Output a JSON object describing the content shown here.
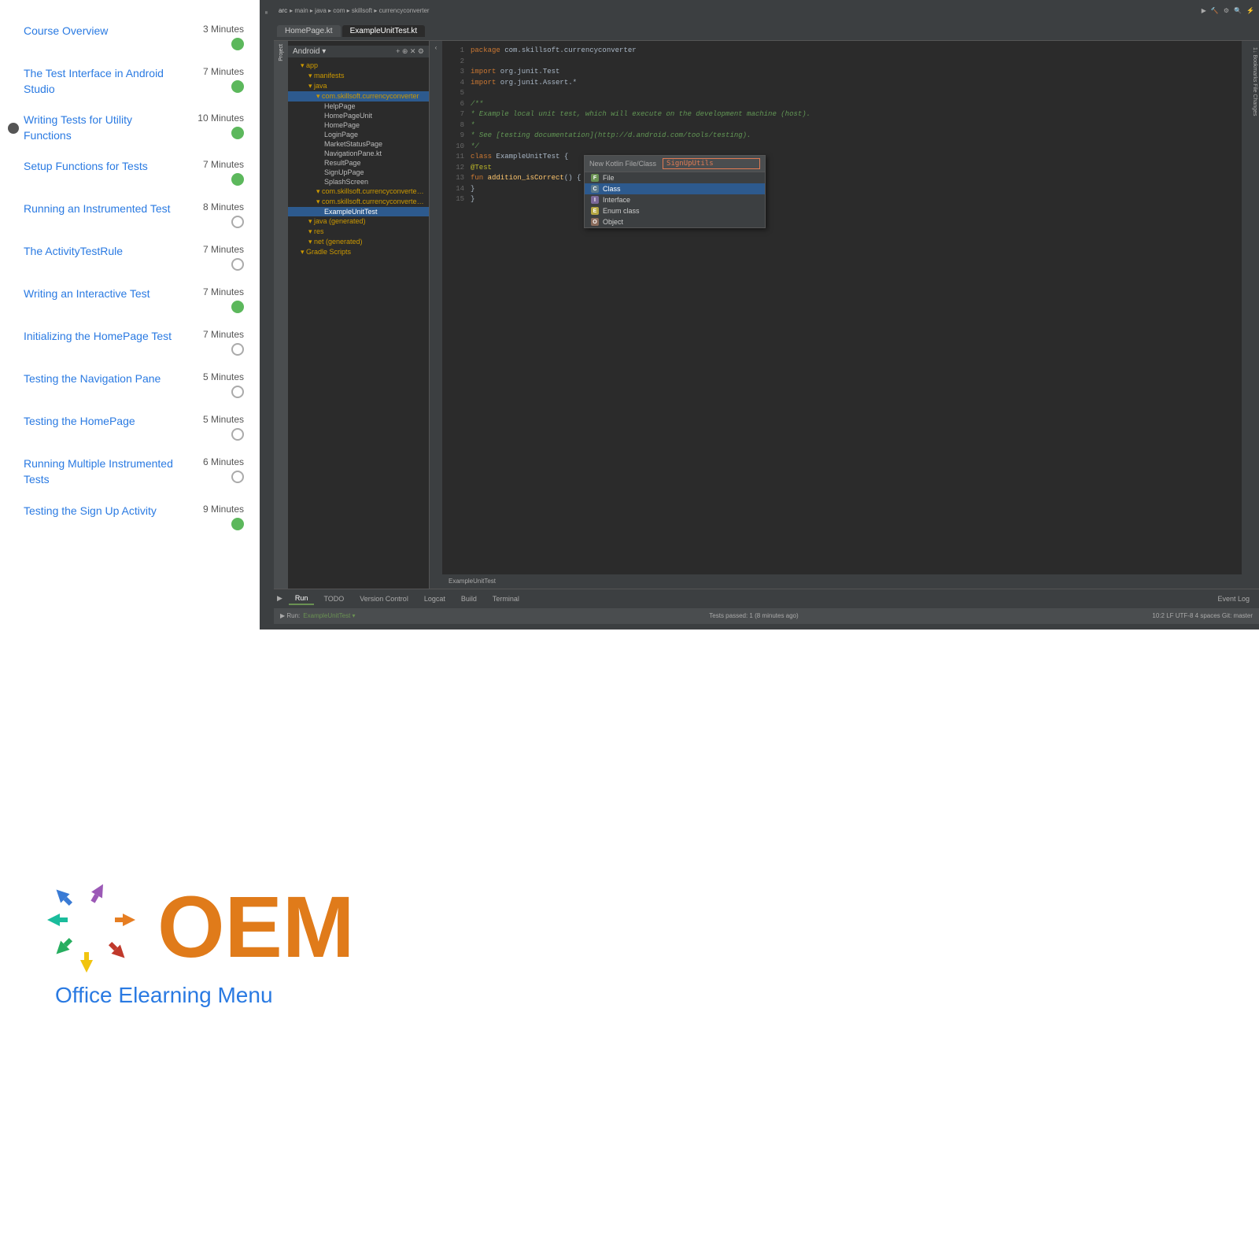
{
  "sidebar": {
    "items": [
      {
        "id": "course-overview",
        "title": "Course Overview",
        "duration": "3 Minutes",
        "status": "green",
        "active": false
      },
      {
        "id": "test-interface",
        "title": "The Test Interface in Android Studio",
        "duration": "7 Minutes",
        "status": "green",
        "active": false
      },
      {
        "id": "writing-tests",
        "title": "Writing Tests for Utility Functions",
        "duration": "10 Minutes",
        "status": "green",
        "active": true
      },
      {
        "id": "setup-functions",
        "title": "Setup Functions for Tests",
        "duration": "7 Minutes",
        "status": "green",
        "active": false
      },
      {
        "id": "instrumented-test",
        "title": "Running an Instrumented Test",
        "duration": "8 Minutes",
        "status": "outline",
        "active": false
      },
      {
        "id": "activity-test-rule",
        "title": "The ActivityTestRule",
        "duration": "7 Minutes",
        "status": "outline",
        "active": false
      },
      {
        "id": "interactive-test",
        "title": "Writing an Interactive Test",
        "duration": "7 Minutes",
        "status": "green",
        "active": false
      },
      {
        "id": "homepage-test",
        "title": "Initializing the HomePage Test",
        "duration": "7 Minutes",
        "status": "outline",
        "active": false
      },
      {
        "id": "nav-pane",
        "title": "Testing the Navigation Pane",
        "duration": "5 Minutes",
        "status": "outline",
        "active": false
      },
      {
        "id": "homepage",
        "title": "Testing the HomePage",
        "duration": "5 Minutes",
        "status": "outline",
        "active": false
      },
      {
        "id": "multiple-tests",
        "title": "Running Multiple Instrumented Tests",
        "duration": "6 Minutes",
        "status": "outline",
        "active": false
      },
      {
        "id": "signup-activity",
        "title": "Testing the Sign Up Activity",
        "duration": "9 Minutes",
        "status": "green",
        "active": false
      }
    ]
  },
  "ide": {
    "tabs": [
      "arc | main | java | com | skilsoft | currencyconverter",
      "ExampleUnitTest ×",
      "HomePage.kt",
      "ExampleUnitTest.kt"
    ],
    "active_tab": "ExampleUnitTest.kt",
    "file_tree": {
      "header": "Android",
      "items": [
        {
          "label": "app",
          "indent": 1,
          "type": "folder"
        },
        {
          "label": "manifests",
          "indent": 2,
          "type": "folder"
        },
        {
          "label": "java",
          "indent": 2,
          "type": "folder"
        },
        {
          "label": "com.skillsoft.currencyconverter",
          "indent": 3,
          "type": "folder",
          "selected": true
        },
        {
          "label": "HelpPage",
          "indent": 4,
          "type": "file"
        },
        {
          "label": "HomePageUnit",
          "indent": 4,
          "type": "file"
        },
        {
          "label": "HomePage",
          "indent": 4,
          "type": "file"
        },
        {
          "label": "LoginPage",
          "indent": 4,
          "type": "file"
        },
        {
          "label": "MarketStatusPage",
          "indent": 4,
          "type": "file"
        },
        {
          "label": "NavigationPane.kt",
          "indent": 4,
          "type": "file"
        },
        {
          "label": "ResultPage",
          "indent": 4,
          "type": "file"
        },
        {
          "label": "SignUpPage",
          "indent": 4,
          "type": "file"
        },
        {
          "label": "SplashScreen",
          "indent": 4,
          "type": "file"
        },
        {
          "label": "com.skillsoft.currencyconverter (android)",
          "indent": 3,
          "type": "folder"
        },
        {
          "label": "com.skillsoft.currencyconverter (test)",
          "indent": 3,
          "type": "folder"
        },
        {
          "label": "ExampleUnitTest",
          "indent": 4,
          "type": "file",
          "selected": true
        },
        {
          "label": "java (generated)",
          "indent": 2,
          "type": "folder"
        },
        {
          "label": "res",
          "indent": 2,
          "type": "folder"
        },
        {
          "label": "net (generated)",
          "indent": 2,
          "type": "folder"
        },
        {
          "label": "Gradle Scripts",
          "indent": 1,
          "type": "folder"
        }
      ]
    },
    "code": {
      "package": "package com.skillsoft.currencyconverter",
      "imports": [
        "import org.junit.Test",
        "import org.junit.Assert.*"
      ],
      "comment_lines": [
        "/**",
        " * Example local unit test, which will execute on the development machine (host).",
        " *",
        " * See [testing documentation](http://d.android.com/tools/testing).",
        " */"
      ],
      "class_def": "class ExampleUnitTest {",
      "annotation": "@Test",
      "method": "fun addition_isCorrect() {",
      "method_body": "}",
      "class_close": "}"
    },
    "autocomplete": {
      "header_label": "New Kotlin File/Class",
      "input_value": "SignUpUtils",
      "items": [
        {
          "type": "file",
          "label": "File"
        },
        {
          "type": "class",
          "label": "Class",
          "selected": true
        },
        {
          "type": "interface",
          "label": "Interface"
        },
        {
          "type": "enum",
          "label": "Enum class"
        },
        {
          "type": "object",
          "label": "Object"
        }
      ]
    },
    "bottom_tabs": [
      "Run",
      "TODO",
      "Version Control",
      "Logcat",
      "Build",
      "Terminal",
      "Event Log"
    ],
    "active_bottom_tab": "Run",
    "run_config": "ExampleUnitTest",
    "status_bar": "Tests passed: 1 (8 minutes ago)",
    "status_bar_right": "10:2  LF  UTF-8  4 spaces  Git: master"
  },
  "logo": {
    "oem_text": "OEM",
    "tagline": "Office Elearning Menu"
  }
}
